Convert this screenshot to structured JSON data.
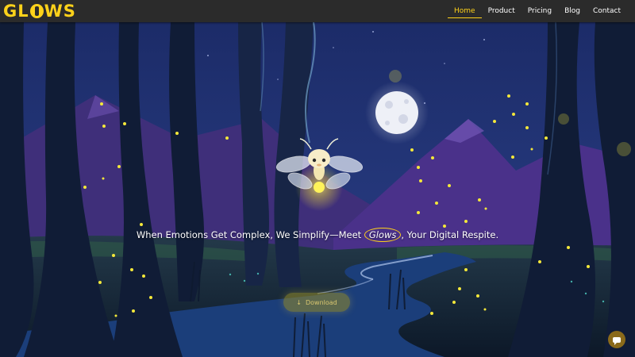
{
  "brand": {
    "logo_text_1": "GL",
    "logo_text_2": "WS",
    "logo_full": "GLOWS",
    "color": "#ffd21a"
  },
  "nav": {
    "items": [
      {
        "label": "Home",
        "active": true
      },
      {
        "label": "Product",
        "active": false
      },
      {
        "label": "Pricing",
        "active": false
      },
      {
        "label": "Blog",
        "active": false
      },
      {
        "label": "Contact",
        "active": false
      }
    ]
  },
  "hero": {
    "tagline_before": "When Emotions Get Complex, We Simplify—Meet ",
    "tagline_highlight": "Glows",
    "tagline_after": ", Your Digital Respite.",
    "download_icon": "↓",
    "download_label": "Download"
  },
  "chat": {
    "icon": "chat-bubble-icon"
  },
  "colors": {
    "nav_bg": "#2b2b2b",
    "accent": "#ffd21a",
    "sky": "#1e3270",
    "mountain": "#5a3c8c",
    "firefly": "#f4e83a"
  }
}
